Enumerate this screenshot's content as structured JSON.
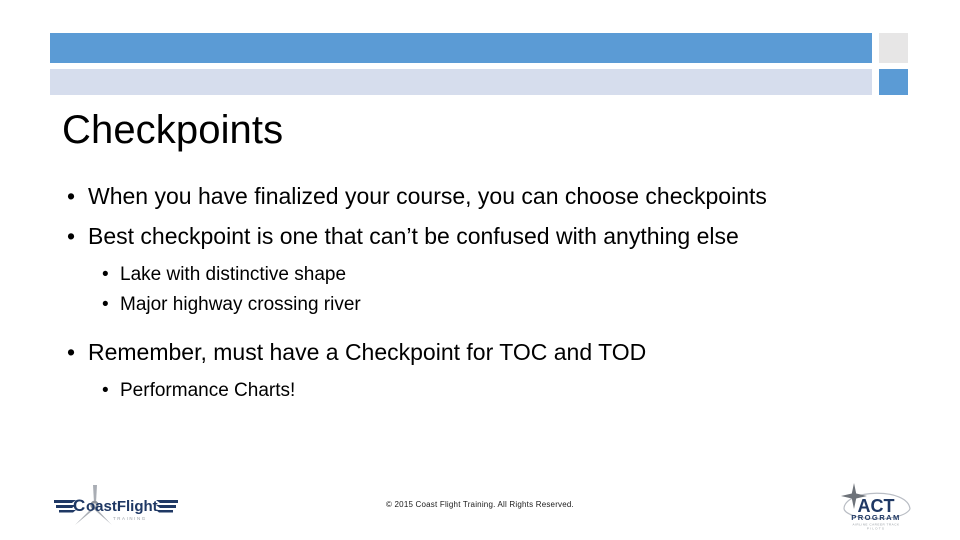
{
  "slide": {
    "title": "Checkpoints",
    "bullets": [
      {
        "level": 1,
        "marker": "•",
        "text": "When you have finalized your course, you can choose checkpoints"
      },
      {
        "level": 1,
        "marker": "•",
        "text": "Best checkpoint is one that can’t be confused with anything else"
      },
      {
        "level": 2,
        "marker": "•",
        "text": "Lake with distinctive shape"
      },
      {
        "level": 2,
        "marker": "•",
        "text": "Major highway crossing river"
      },
      {
        "level": 1,
        "marker": "•",
        "text": "Remember, must have a Checkpoint for TOC and TOD"
      },
      {
        "level": 2,
        "marker": "•",
        "text": "Performance Charts!"
      }
    ]
  },
  "footer": {
    "copyright": "© 2015 Coast Flight Training. All Rights Reserved."
  },
  "logos": {
    "left": {
      "name": "coast-flight-training-logo",
      "wordmark_primary": "C",
      "wordmark_secondary": "oastFlight",
      "tagline": "T R A I N I N G"
    },
    "right": {
      "name": "act-program-logo",
      "wordmark": "ACT",
      "subtitle": "PROGRAM",
      "tagline_line1": "AIRLINE CAREER TRACK",
      "tagline_line2": "PILOTS"
    }
  },
  "colors": {
    "bar_blue": "#5b9bd5",
    "bar_light_blue": "#d6dded",
    "bar_gray": "#e7e6e6",
    "text": "#000000",
    "background": "#ffffff",
    "logo_navy": "#1f3864",
    "logo_gray": "#9aa0a6"
  }
}
